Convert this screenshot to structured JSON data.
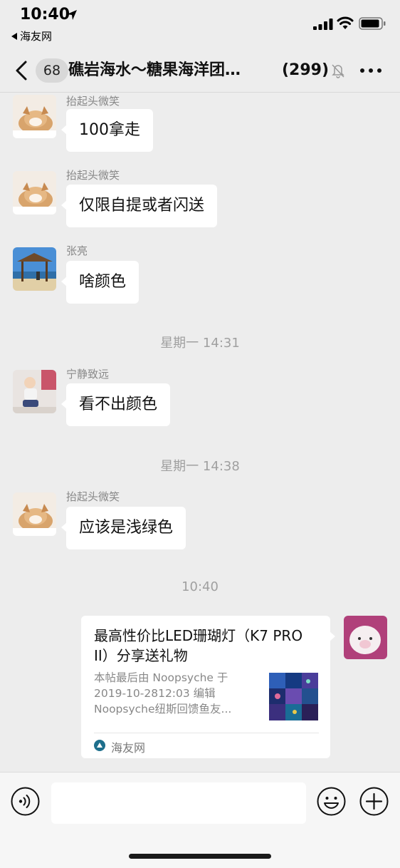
{
  "status_bar": {
    "time": "10:40",
    "back_app": "海友网"
  },
  "nav": {
    "unread_count": "68",
    "title": "礁岩海水～糖果海洋团…",
    "member_count": "(299)",
    "icons": [
      "back-chevron-icon",
      "mute-bell-icon",
      "more-dots-icon"
    ]
  },
  "messages": [
    {
      "sender": "抬起头微笑",
      "text": "100拿走"
    },
    {
      "sender": "抬起头微笑",
      "text": "仅限自提或者闪送"
    },
    {
      "sender": "张亮",
      "text": "啥颜色"
    },
    {
      "sender": "宁静致远",
      "text": "看不出颜色"
    },
    {
      "sender": "抬起头微笑",
      "text": "应该是浅绿色"
    }
  ],
  "time_separators": [
    "星期一 14:31",
    "星期一 14:38",
    "10:40"
  ],
  "link_card": {
    "title": "最高性价比LED珊瑚灯（K7 PRO II）分享送礼物",
    "desc_lines": [
      "本帖最后由 Noopsyche 于",
      "2019-10-2812:03 编辑",
      "Noopsyche纽斯回馈鱼友..."
    ],
    "source": "海友网"
  },
  "input": {
    "value": "",
    "placeholder": ""
  },
  "colors": {
    "background": "#ededed",
    "bubble": "#ffffff",
    "secondary_text": "#888888"
  }
}
